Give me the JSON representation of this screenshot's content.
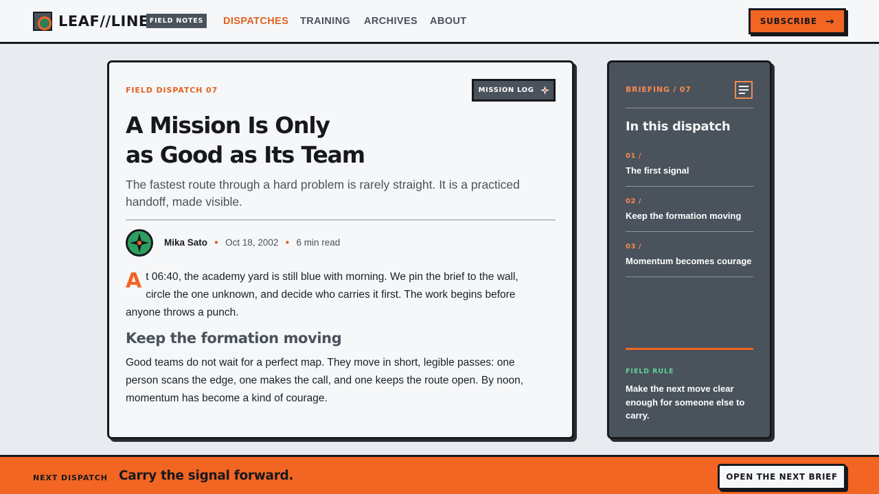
{
  "header": {
    "brand_name": "LEAF//LINE",
    "brand_tag": "Field Notes",
    "brand_icon": "leaf-badge-icon",
    "nav": [
      {
        "label": "DISPATCHES",
        "active": true
      },
      {
        "label": "TRAINING",
        "active": false
      },
      {
        "label": "ARCHIVES",
        "active": false
      },
      {
        "label": "ABOUT",
        "active": false
      }
    ],
    "subscribe_label": "Subscribe",
    "subscribe_icon": "arrow-right-icon"
  },
  "article": {
    "eyebrow": "Field Dispatch 07",
    "mission_log_label": "Mission Log",
    "mission_log_icon": "compass-star-icon",
    "headline_line1": "A Mission Is Only",
    "headline_line2": "as Good as Its Team",
    "deck": "The fastest route through a hard problem is rarely straight. It is a practiced handoff, made visible.",
    "author": "Mika Sato",
    "date": "Oct 18, 2002",
    "read_time": "6 min read",
    "dropcap": "A",
    "paragraph1": "t 06:40, the academy yard is still blue with morning. We pin the brief to the wall, circle the one unknown, and decide who carries it first. The work begins before anyone throws a punch.",
    "subhead": "Keep the formation moving",
    "paragraph2": "Good teams do not wait for a perfect map. They move in short, legible passes: one person scans the edge, one makes the call, and one keeps the route open. By noon, momentum has become a kind of courage."
  },
  "sidebar": {
    "eyebrow": "Briefing / 07",
    "toc_icon": "list-icon",
    "title": "In this dispatch",
    "items": [
      {
        "num": "01 /",
        "label": "The first signal"
      },
      {
        "num": "02 /",
        "label": "Keep the formation moving"
      },
      {
        "num": "03 /",
        "label": "Momentum becomes courage"
      }
    ],
    "rule_eyebrow": "Field Rule",
    "rule_text": "Make the next move clear enough for someone else to carry."
  },
  "footer": {
    "next_label": "Next Dispatch",
    "next_title": "Carry the signal forward.",
    "next_button": "Open the next brief"
  },
  "colors": {
    "accent": "#f26522",
    "ink": "#16181c",
    "slate": "#4a525c",
    "paper": "#f5f7f9",
    "green": "#2e9e5f",
    "mint": "#5ed39a"
  }
}
